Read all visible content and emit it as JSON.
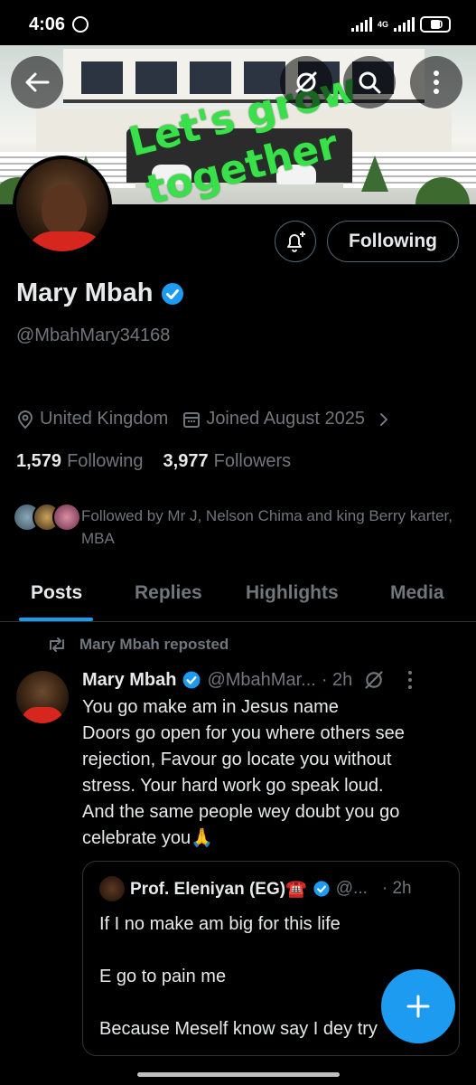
{
  "status_bar": {
    "time": "4:06",
    "network": "4G",
    "battery": "30"
  },
  "banner": {
    "text_line1": "Let's grow",
    "text_line2": "together"
  },
  "profile": {
    "follow_state_label": "Following",
    "name": "Mary Mbah",
    "handle": "@MbahMary34168",
    "location": "United Kingdom",
    "joined": "Joined August 2025",
    "following_count": "1,579",
    "following_label": "Following",
    "followers_count": "3,977",
    "followers_label": "Followers",
    "followed_by": "Followed by Mr J, Nelson Chima and king Berry karter, MBA"
  },
  "tabs": [
    "Posts",
    "Replies",
    "Highlights",
    "Media"
  ],
  "post": {
    "repost_label": "Mary Mbah reposted",
    "author_name": "Mary Mbah",
    "author_handle": "@MbahMar...",
    "time": "· 2h",
    "lines": [
      "You go make am in Jesus name",
      "Doors go open for you where others see",
      "rejection, Favour go locate you without",
      "stress. Your hard work go speak loud.",
      "And the same people wey doubt you go",
      "celebrate you🙏"
    ],
    "quote": {
      "author_name": "Prof. Eleniyan (EG)☎️",
      "author_handle": "@...",
      "time": "· 2h",
      "lines": [
        "If I no make am big for this life",
        "E go to pain me",
        "Because Meself know say I dey try"
      ]
    }
  },
  "colors": {
    "accent": "#1d9bf0",
    "banner_text": "#39e04a",
    "muted": "#71767b"
  }
}
